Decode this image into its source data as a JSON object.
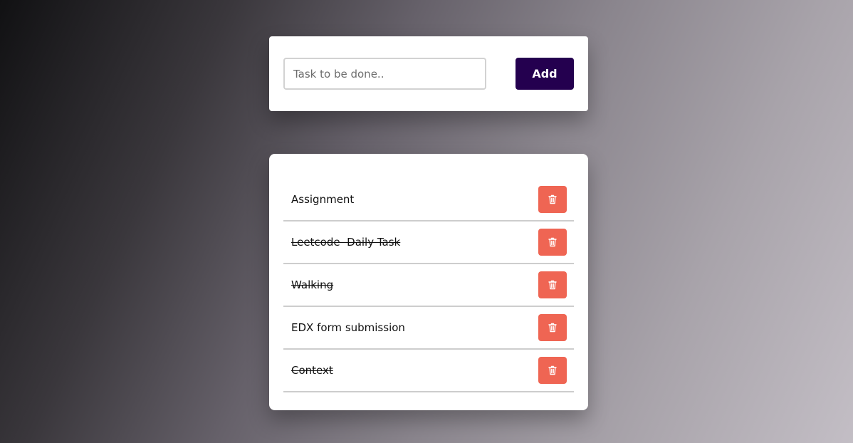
{
  "input_section": {
    "task_input": {
      "value": "",
      "placeholder": "Task to be done.."
    },
    "add_label": "Add"
  },
  "tasks": [
    {
      "text": "Assignment",
      "completed": false
    },
    {
      "text": "Leetcode  Daily Task",
      "completed": true
    },
    {
      "text": "Walking",
      "completed": true
    },
    {
      "text": "EDX form submission",
      "completed": false
    },
    {
      "text": "Context",
      "completed": true
    }
  ],
  "icons": {
    "delete": "trash-icon"
  },
  "colors": {
    "add_button": "#24004f",
    "delete_button": "#ef6553"
  }
}
